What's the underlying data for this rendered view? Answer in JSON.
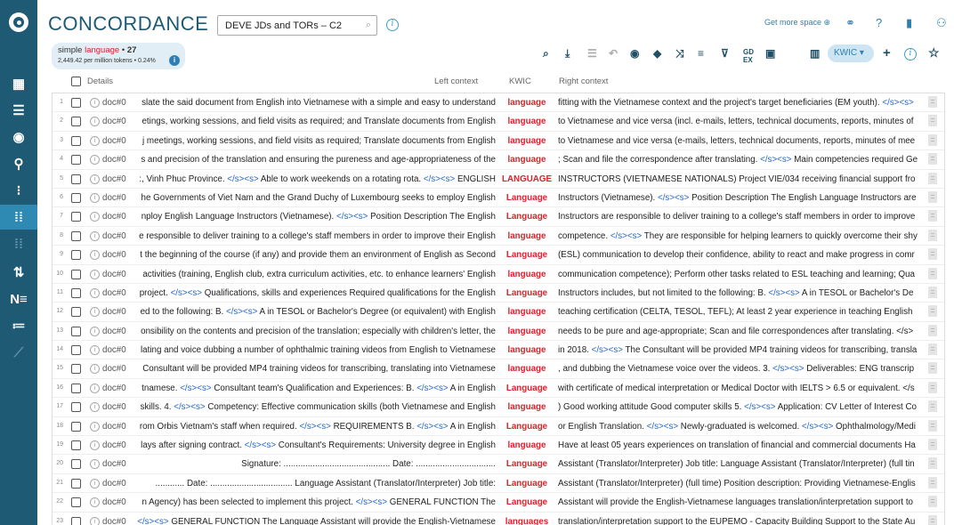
{
  "brand": "CONCORDANCE",
  "corpus": "DEVE JDs and TORs – C2",
  "header_links": {
    "get_more_space": "Get more space"
  },
  "summary": {
    "query_prefix": "simple",
    "query_term": "language",
    "bullet": "•",
    "count": "27",
    "stats": "2,449.42 per million tokens • 0.24%",
    "info_icon": "i"
  },
  "toolbar": {
    "view_mode": "KWIC"
  },
  "columns": {
    "details": "Details",
    "left": "Left context",
    "kwic": "KWIC",
    "right": "Right context"
  },
  "rows": [
    {
      "n": "1",
      "doc": "doc#0",
      "left": "slate the said document from English into Vietnamese with a simple and easy to understand",
      "kwic": "language",
      "right": "fitting with the Vietnamese context and the project's target beneficiaries (EM youth). </s><s>"
    },
    {
      "n": "2",
      "doc": "doc#0",
      "left": "etings, working sessions, and field visits as required; and Translate documents from English",
      "kwic": "language",
      "right": "to Vietnamese and vice versa (incl. e-mails, letters, technical documents, reports, minutes of"
    },
    {
      "n": "3",
      "doc": "doc#0",
      "left": "j meetings, working sessions, and field visits as required; Translate documents from English",
      "kwic": "language",
      "right": "to Vietnamese and vice versa (e-mails, letters, technical documents, reports, minutes of mee"
    },
    {
      "n": "4",
      "doc": "doc#0",
      "left": "s and precision of the translation and ensuring the pureness and age-appropriateness of the",
      "kwic": "language",
      "right": "; Scan and file the correspondence after translating. </s><s> Main competencies required Ge"
    },
    {
      "n": "5",
      "doc": "doc#0",
      "left": ":, Vinh Phuc Province. </s><s> Able to work weekends on a rotating rota. </s><s> ENGLISH",
      "kwic": "LANGUAGE",
      "right": "INSTRUCTORS (VIETNAMESE NATIONALS) Project VIE/034 receiving financial support fro"
    },
    {
      "n": "6",
      "doc": "doc#0",
      "left": "he Governments of Viet Nam and the Grand Duchy of Luxembourg seeks to employ English",
      "kwic": "Language",
      "right": "Instructors (Vietnamese). </s><s> Position Description The English Language Instructors are"
    },
    {
      "n": "7",
      "doc": "doc#0",
      "left": "nploy English Language Instructors (Vietnamese). </s><s> Position Description The English",
      "kwic": "Language",
      "right": "Instructors are responsible to deliver training to a college's staff members in order to improve"
    },
    {
      "n": "8",
      "doc": "doc#0",
      "left": "e responsible to deliver training to a college's staff members in order to improve their English",
      "kwic": "language",
      "right": "competence. </s><s> They are responsible for helping learners to quickly overcome their shy"
    },
    {
      "n": "9",
      "doc": "doc#0",
      "left": "t the beginning of the course (if any) and provide them an environment of English as Second",
      "kwic": "Language",
      "right": "(ESL) communication to develop their confidence, ability to react and make progress in comr"
    },
    {
      "n": "10",
      "doc": "doc#0",
      "left": "activities (training, English club, extra curriculum activities, etc. to enhance learners' English",
      "kwic": "language",
      "right": "communication competence); Perform other tasks related to ESL teaching and learning; Qua"
    },
    {
      "n": "11",
      "doc": "doc#0",
      "left": "project. </s><s> Qualifications, skills and experiences Required qualifications for the English",
      "kwic": "Language",
      "right": "Instructors includes, but not limited to the following: B. </s><s> A in TESOL or Bachelor's De"
    },
    {
      "n": "12",
      "doc": "doc#0",
      "left": "ed to the following: B. </s><s> A in TESOL or Bachelor's Degree (or equivalent) with English",
      "kwic": "language",
      "right": "teaching certification (CELTA, TESOL, TEFL); At least 2 year experience in teaching English"
    },
    {
      "n": "13",
      "doc": "doc#0",
      "left": "onsibility on the contents and precision of the translation; especially with children's letter, the",
      "kwic": "language",
      "right": "needs to be pure and age-appropriate; Scan and file correspondences after translating. </s>"
    },
    {
      "n": "14",
      "doc": "doc#0",
      "left": "lating and voice dubbing a number of ophthalmic training videos from English to Vietnamese",
      "kwic": "language",
      "right": "in 2018. </s><s> The Consultant will be provided MP4 training videos for transcribing, transla"
    },
    {
      "n": "15",
      "doc": "doc#0",
      "left": "Consultant will be provided MP4 training videos for transcribing, translating into Vietnamese",
      "kwic": "language",
      "right": ", and dubbing the Vietnamese voice over the videos. 3. </s><s> Deliverables: ENG transcrip"
    },
    {
      "n": "16",
      "doc": "doc#0",
      "left": "tnamese. </s><s> Consultant team's Qualification and Experiences: B. </s><s> A in English",
      "kwic": "Language",
      "right": "with certificate of medical interpretation or Medical Doctor with IELTS > 6.5 or equivalent. </s"
    },
    {
      "n": "17",
      "doc": "doc#0",
      "left": "skills. 4. </s><s> Competency: Effective communication skills (both Vietnamese and English",
      "kwic": "language",
      "right": ") Good working attitude Good computer skills 5. </s><s> Application: CV Letter of Interest Co"
    },
    {
      "n": "18",
      "doc": "doc#0",
      "left": "rom Orbis Vietnam's staff when required. </s><s> REQUIREMENTS B. </s><s> A in English",
      "kwic": "Language",
      "right": "or English Translation. </s><s> Newly-graduated is welcomed. </s><s> Ophthalmology/Medi"
    },
    {
      "n": "19",
      "doc": "doc#0",
      "left": "lays after signing contract. </s><s> Consultant's Requirements: University degree in English",
      "kwic": "language",
      "right": "Have at least 05 years experiences on translation of financial and commercial documents Ha"
    },
    {
      "n": "20",
      "doc": "doc#0",
      "left": "Signature: ............................................ Date: .................................",
      "kwic": "Language",
      "right": "Assistant (Translator/Interpreter) Job title: Language Assistant (Translator/Interpreter) (full tin"
    },
    {
      "n": "21",
      "doc": "doc#0",
      "left": "............ Date: .................................. Language Assistant (Translator/Interpreter) Job title:",
      "kwic": "Language",
      "right": "Assistant (Translator/Interpreter) (full time) Position description: Providing Vietnamese-Englis"
    },
    {
      "n": "22",
      "doc": "doc#0",
      "left": "n Agency) has been selected to implement this project. </s><s> GENERAL FUNCTION The",
      "kwic": "Language",
      "right": "Assistant will provide the English-Vietnamese languages translation/interpretation support to"
    },
    {
      "n": "23",
      "doc": "doc#0",
      "left": "</s><s> GENERAL FUNCTION The Language Assistant will provide the English-Vietnamese",
      "kwic": "languages",
      "right": "translation/interpretation support to the EUPEMO - Capacity Building Support to the State Au"
    }
  ]
}
